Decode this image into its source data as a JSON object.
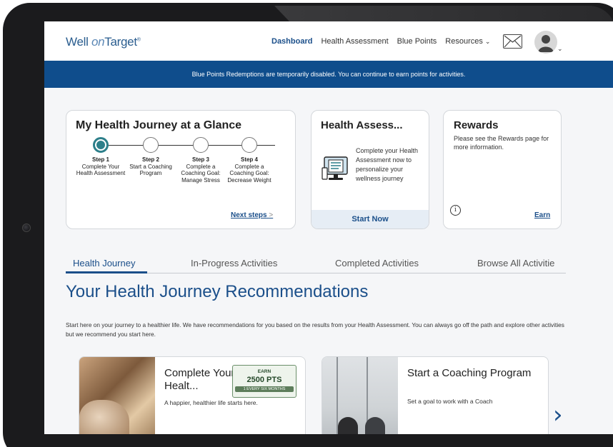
{
  "nav": {
    "logo_well": "Well ",
    "logo_on": "on",
    "logo_target": "Target",
    "logo_mark": "®",
    "links": [
      "Dashboard",
      "Health Assessment",
      "Blue Points",
      "Resources"
    ],
    "resources_chevron": "⌄",
    "avatar_caret": "⌄"
  },
  "banner": {
    "text": "Blue Points Redemptions are temporarily disabled. You can continue to earn points for activities."
  },
  "journey": {
    "title": "My Health Journey at a Glance",
    "steps": [
      {
        "title": "Step 1",
        "desc": "Complete Your Health Assessment"
      },
      {
        "title": "Step 2",
        "desc": "Start a Coaching Program"
      },
      {
        "title": "Step 3",
        "desc": "Complete a Coaching Goal: Manage Stress"
      },
      {
        "title": "Step 4",
        "desc": "Complete a Coaching Goal: Decrease Weight"
      }
    ],
    "next_steps": "Next steps",
    "next_arrow": ">"
  },
  "assessment": {
    "title": "Health Assess...",
    "text": "Complete your Health Assessment now to personalize your wellness journey",
    "button": "Start Now"
  },
  "rewards": {
    "title": "Rewards",
    "text": "Please see the Rewards page for more information.",
    "info_symbol": "i",
    "earn_link": "Earn"
  },
  "tabs": [
    "Health Journey",
    "In-Progress Activities",
    "Completed Activities",
    "Browse All Activitie"
  ],
  "section": {
    "title": "Your Health Journey Recommendations",
    "description": "Start here on your journey to a healthier life. We have recommendations for you based on the results from your Health Assessment. You can always go off the path and explore other activities but we recommend you start here."
  },
  "recommendations": [
    {
      "title": "Complete Your Healt...",
      "subtitle": "A happier, healthier life starts here.",
      "badge": {
        "label": "EARN",
        "points": "2500 PTS",
        "frequency": "1 EVERY SIX MONTHS"
      }
    },
    {
      "title": "Start a Coaching Program",
      "subtitle": "Set a goal to work with a Coach"
    }
  ],
  "carousel": {
    "next_symbol": "›"
  },
  "colors": {
    "primary": "#1b4f8a",
    "banner": "#0f4d8c",
    "step_active": "#2d7f8a",
    "badge_green": "#5d7d5b"
  }
}
